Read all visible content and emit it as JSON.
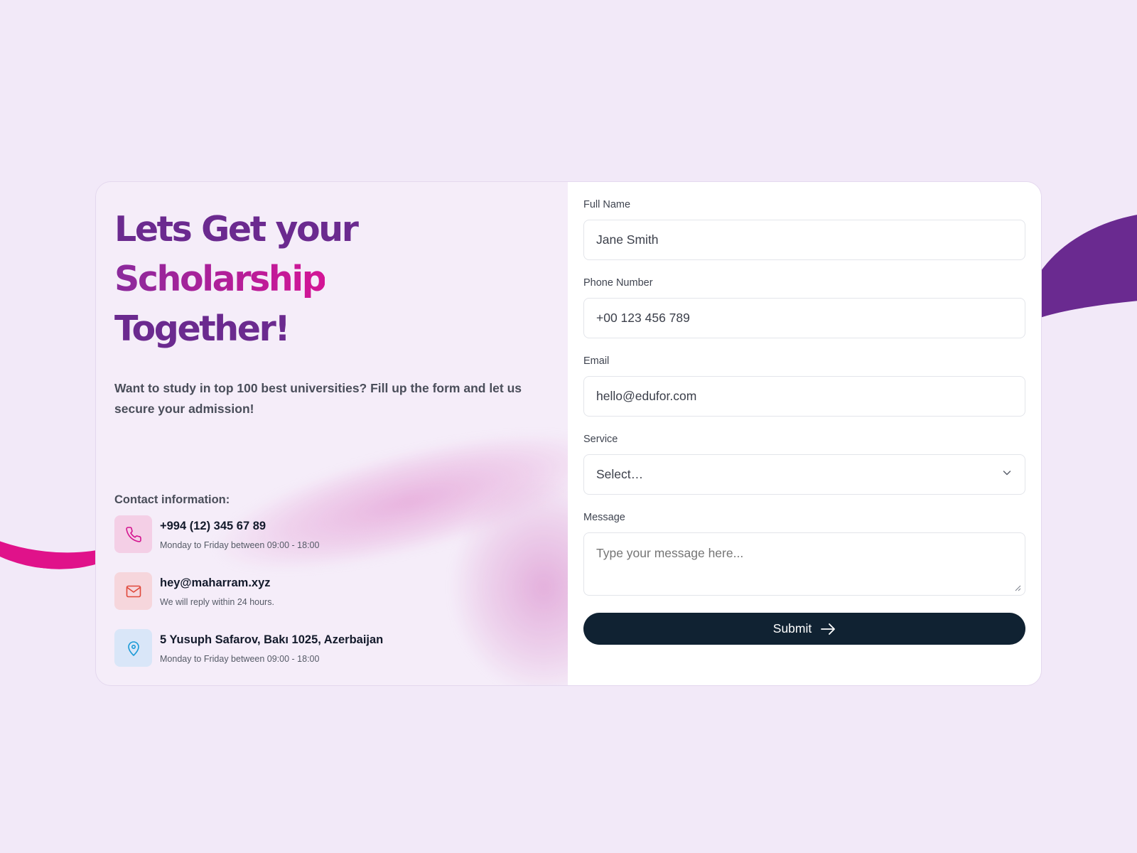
{
  "hero": {
    "headline_part1": "Lets Get your ",
    "headline_accent": "Scholarship",
    "headline_part2": "Together!",
    "lead": "Want to study in top 100 best universities? Fill up the form and let us secure your admission!"
  },
  "contact": {
    "title": "Contact information:",
    "items": [
      {
        "icon": "phone-icon",
        "main": "+994 (12) 345 67 89",
        "sub": "Monday to Friday between 09:00 - 18:00"
      },
      {
        "icon": "mail-icon",
        "main": "hey@maharram.xyz",
        "sub": "We will reply within 24 hours."
      },
      {
        "icon": "map-pin-icon",
        "main": "5 Yusuph Safarov, Bakı 1025, Azerbaijan",
        "sub": "Monday to Friday between 09:00 - 18:00"
      }
    ]
  },
  "form": {
    "full_name": {
      "label": "Full Name",
      "value": "Jane Smith"
    },
    "phone": {
      "label": "Phone Number",
      "value": "+00 123 456 789"
    },
    "email": {
      "label": "Email",
      "value": "hello@edufor.com"
    },
    "service": {
      "label": "Service",
      "value": "Select…"
    },
    "message": {
      "label": "Message",
      "placeholder": "Type your message here..."
    },
    "submit_label": "Submit"
  },
  "colors": {
    "background": "#f2e9f8",
    "headline_purple": "#6b2a8f",
    "headline_magenta": "#d41596",
    "ribbon_magenta": "#e0128a",
    "ribbon_purple": "#6a2a90",
    "submit_bg": "#102232"
  }
}
